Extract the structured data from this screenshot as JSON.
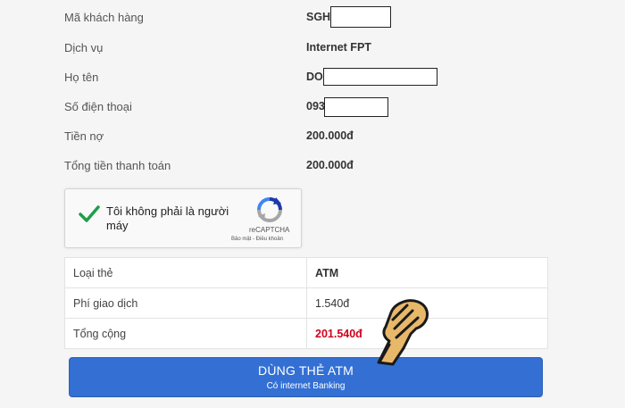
{
  "info": {
    "customer_code": {
      "label": "Mã khách hàng",
      "value": "SGH"
    },
    "service": {
      "label": "Dịch vụ",
      "value": "Internet FPT"
    },
    "name": {
      "label": "Họ tên",
      "value": "DO"
    },
    "phone": {
      "label": "Số điện thoại",
      "value": "093"
    },
    "debt": {
      "label": "Tiền nợ",
      "value": "200.000đ"
    },
    "total_payment": {
      "label": "Tổng tiền thanh toán",
      "value": "200.000đ"
    }
  },
  "captcha": {
    "text": "Tôi không phải là người máy",
    "brand": "reCAPTCHA",
    "terms": "Bảo mật - Điều khoản"
  },
  "summary": {
    "rows": [
      {
        "label": "Loại thẻ",
        "value": "ATM"
      },
      {
        "label": "Phí giao dịch",
        "value": "1.540đ"
      },
      {
        "label": "Tổng cộng",
        "value": "201.540đ"
      }
    ]
  },
  "pay_button": {
    "label": "DÙNG THẺ ATM",
    "sublabel": "Có internet Banking"
  },
  "colors": {
    "accent": "#3470d3",
    "total_red": "#d0021b",
    "check_green": "#1e9e4a"
  }
}
